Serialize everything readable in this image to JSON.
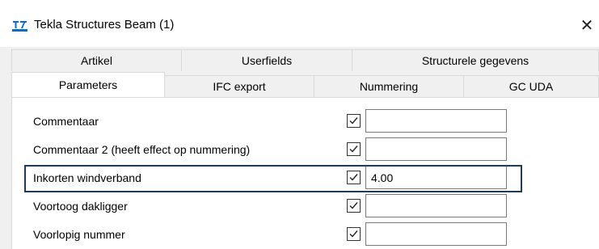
{
  "window": {
    "title": "Tekla Structures  Beam (1)",
    "close_symbol": "✕",
    "icon": "tekla-app-icon"
  },
  "tabs_back": [
    {
      "label": "Artikel"
    },
    {
      "label": "Userfields"
    },
    {
      "label": "Structurele gegevens"
    }
  ],
  "tabs_front": [
    {
      "label": "Parameters",
      "active": true
    },
    {
      "label": "IFC export"
    },
    {
      "label": "Nummering"
    },
    {
      "label": "GC UDA"
    }
  ],
  "properties": [
    {
      "label": "Commentaar",
      "checked": true,
      "value": ""
    },
    {
      "label": "Commentaar 2 (heeft effect op nummering)",
      "checked": true,
      "value": ""
    },
    {
      "label": "Inkorten windverband",
      "checked": true,
      "value": "4.00",
      "highlighted": true
    },
    {
      "label": "Voortoog dakligger",
      "checked": true,
      "value": ""
    },
    {
      "label": "Voorlopig nummer",
      "checked": true,
      "value": ""
    }
  ],
  "colors": {
    "highlight_border": "#1f3b5c",
    "dialog_background": "#f0f0f0"
  }
}
